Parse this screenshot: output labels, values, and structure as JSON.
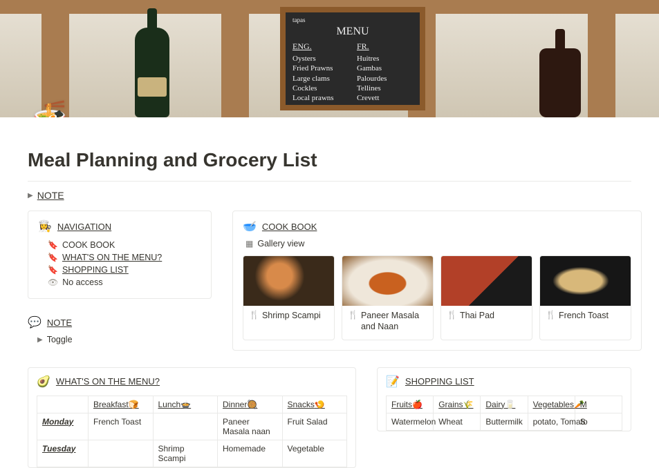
{
  "page": {
    "title": "Meal Planning and Grocery List",
    "icon": "🍜"
  },
  "top_toggle": {
    "label": "NOTE"
  },
  "navigation": {
    "icon": "👩‍🍳",
    "heading": "NAVIGATION",
    "items": [
      {
        "label": "COOK BOOK",
        "underline": false
      },
      {
        "label": "WHAT'S ON THE MENU?",
        "underline": true
      },
      {
        "label": "SHOPPING LIST",
        "underline": true
      }
    ],
    "no_access": "No access"
  },
  "note_block": {
    "icon": "💬",
    "heading": "NOTE",
    "toggle_label": "Toggle"
  },
  "cookbook": {
    "icon": "🥣",
    "heading": "COOK BOOK",
    "view_label": "Gallery view",
    "items": [
      {
        "title": "Shrimp Scampi"
      },
      {
        "title": "Paneer Masala and Naan"
      },
      {
        "title": "Thai Pad"
      },
      {
        "title": "French Toast"
      }
    ]
  },
  "menu_db": {
    "icon": "🥑",
    "heading": "WHAT'S ON THE MENU?",
    "columns": [
      {
        "label": "Breakfast",
        "emoji": "🍞"
      },
      {
        "label": "Lunch",
        "emoji": "🍲"
      },
      {
        "label": "Dinner",
        "emoji": "🥘"
      },
      {
        "label": "Snacks",
        "emoji": "🍤"
      }
    ],
    "rows": [
      {
        "day": "Monday",
        "cells": [
          "French Toast",
          "",
          "Paneer Masala naan",
          "Fruit Salad"
        ]
      },
      {
        "day": "Tuesday",
        "cells": [
          "",
          "Shrimp Scampi",
          "Homemade",
          "Vegetable"
        ]
      }
    ]
  },
  "shopping_db": {
    "icon": "📝",
    "heading": "SHOPPING LIST",
    "columns": [
      {
        "label": "Fruits",
        "emoji": "🍎"
      },
      {
        "label": "Grains",
        "emoji": "🌾"
      },
      {
        "label": "Dairy",
        "emoji": "🥛"
      },
      {
        "label": "Vegetables",
        "emoji": "🥕"
      },
      {
        "label": "M",
        "emoji": ""
      }
    ],
    "rows": [
      {
        "cells": [
          "Watermelon",
          "Wheat",
          "Buttermilk",
          "potato, Tomato",
          "S"
        ]
      }
    ]
  },
  "chalkboard": {
    "title": "MENU",
    "subtitle": "tapas",
    "left_head": "ENG.",
    "right_head": "FR.",
    "left_items": [
      "Oysters",
      "Fried Prawns",
      "Large clams",
      "Cockles",
      "Local prawns"
    ],
    "right_items": [
      "Huitres",
      "Gambas",
      "Palourdes",
      "Tellines",
      "Crevett"
    ]
  }
}
